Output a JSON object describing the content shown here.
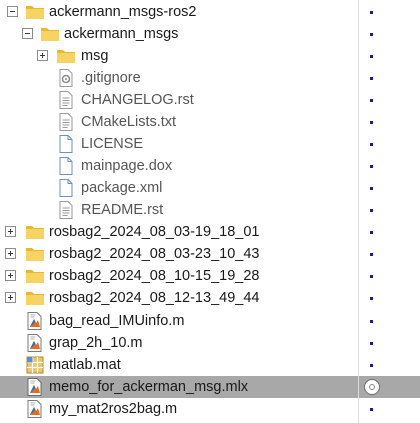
{
  "tree": {
    "rows": [
      {
        "label": "ackermann_msgs-ros2",
        "icon": "folder-icon",
        "toggle": "expanded"
      },
      {
        "label": "ackermann_msgs",
        "icon": "folder-icon",
        "toggle": "expanded"
      },
      {
        "label": "msg",
        "icon": "folder-icon",
        "toggle": "collapsed"
      },
      {
        "label": ".gitignore",
        "icon": "gitignore-file-icon"
      },
      {
        "label": "CHANGELOG.rst",
        "icon": "text-file-icon"
      },
      {
        "label": "CMakeLists.txt",
        "icon": "text-file-icon"
      },
      {
        "label": "LICENSE",
        "icon": "blank-file-icon"
      },
      {
        "label": "mainpage.dox",
        "icon": "blank-file-icon"
      },
      {
        "label": "package.xml",
        "icon": "blank-file-icon"
      },
      {
        "label": "README.rst",
        "icon": "text-file-icon"
      },
      {
        "label": "rosbag2_2024_08_03-19_18_01",
        "icon": "folder-icon",
        "toggle": "collapsed"
      },
      {
        "label": "rosbag2_2024_08_03-23_10_43",
        "icon": "folder-icon",
        "toggle": "collapsed"
      },
      {
        "label": "rosbag2_2024_08_10-15_19_28",
        "icon": "folder-icon",
        "toggle": "collapsed"
      },
      {
        "label": "rosbag2_2024_08_12-13_49_44",
        "icon": "folder-icon",
        "toggle": "collapsed"
      },
      {
        "label": "bag_read_IMUinfo.m",
        "icon": "matlab-script-icon",
        "status": "dot"
      },
      {
        "label": "grap_2h_10.m",
        "icon": "matlab-script-icon",
        "status": "dot"
      },
      {
        "label": "matlab.mat",
        "icon": "mat-file-icon",
        "status": "dot"
      },
      {
        "label": "memo_for_ackerman_msg.mlx",
        "icon": "live-script-icon",
        "status": "ring",
        "selected": true
      },
      {
        "label": "my_mat2ros2bag.m",
        "icon": "matlab-script-icon",
        "status": "dot"
      }
    ]
  },
  "colors": {
    "folder": "#f2c94c",
    "selection": "#a8a8a8",
    "status_dot": "#1b1b8c",
    "matlab_orange": "#e46c1f"
  }
}
